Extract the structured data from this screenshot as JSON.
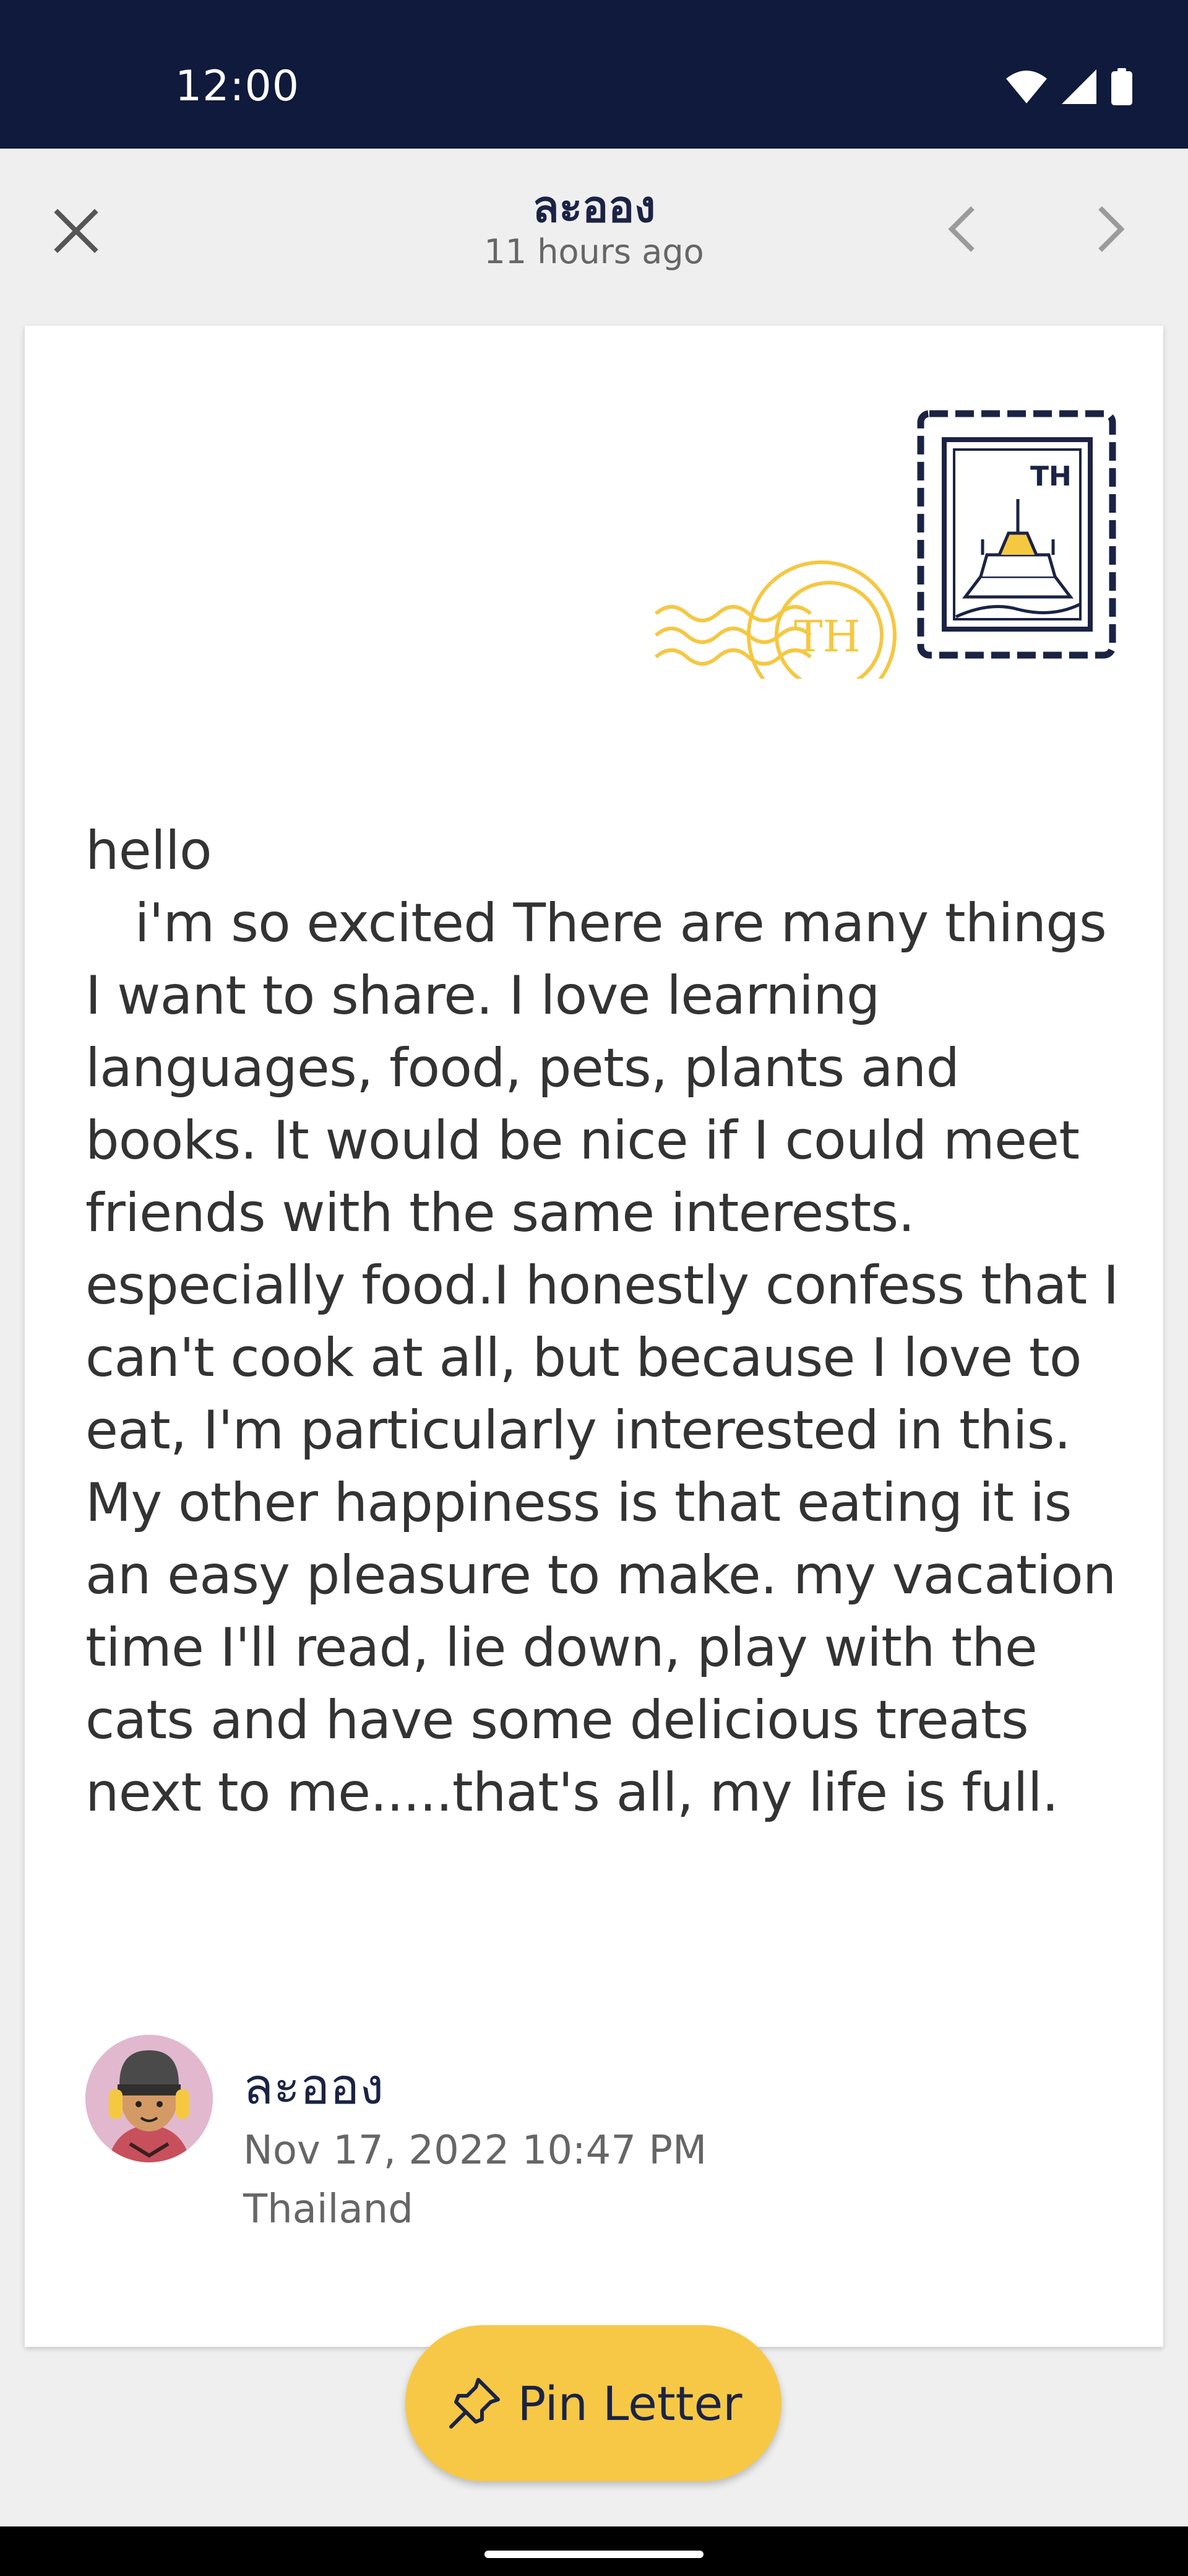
{
  "status_bar": {
    "time": "12:00",
    "icons": [
      "wifi-icon",
      "signal-icon",
      "battery-icon"
    ]
  },
  "header": {
    "title": "ละออง",
    "subtitle": "11 hours ago",
    "close_icon": "close-icon",
    "prev_icon": "chevron-left-icon",
    "next_icon": "chevron-right-icon"
  },
  "letter": {
    "stamp_code": "TH",
    "postmark_code": "TH",
    "body": "hello\n   i'm so excited There are many things I want to share. I love learning languages, food, pets, plants and books. It would be nice if I could meet friends with the same interests. especially food.I honestly confess that I can't cook at all, but because I love to eat, I'm particularly interested in this. My other happiness is that eating it is an easy pleasure to make. my vacation time I'll read, lie down, play with the cats and have some delicious treats next to me.....that's all, my life is full."
  },
  "author": {
    "name": "ละออง",
    "date": "Nov 17, 2022 10:47 PM",
    "country": "Thailand"
  },
  "pin_button": {
    "label": "Pin Letter",
    "icon": "pin-icon"
  },
  "colors": {
    "status_bar": "#0f1a3c",
    "accent_yellow": "#f7c846",
    "navy": "#1b2345",
    "postmark": "#f5c842"
  }
}
